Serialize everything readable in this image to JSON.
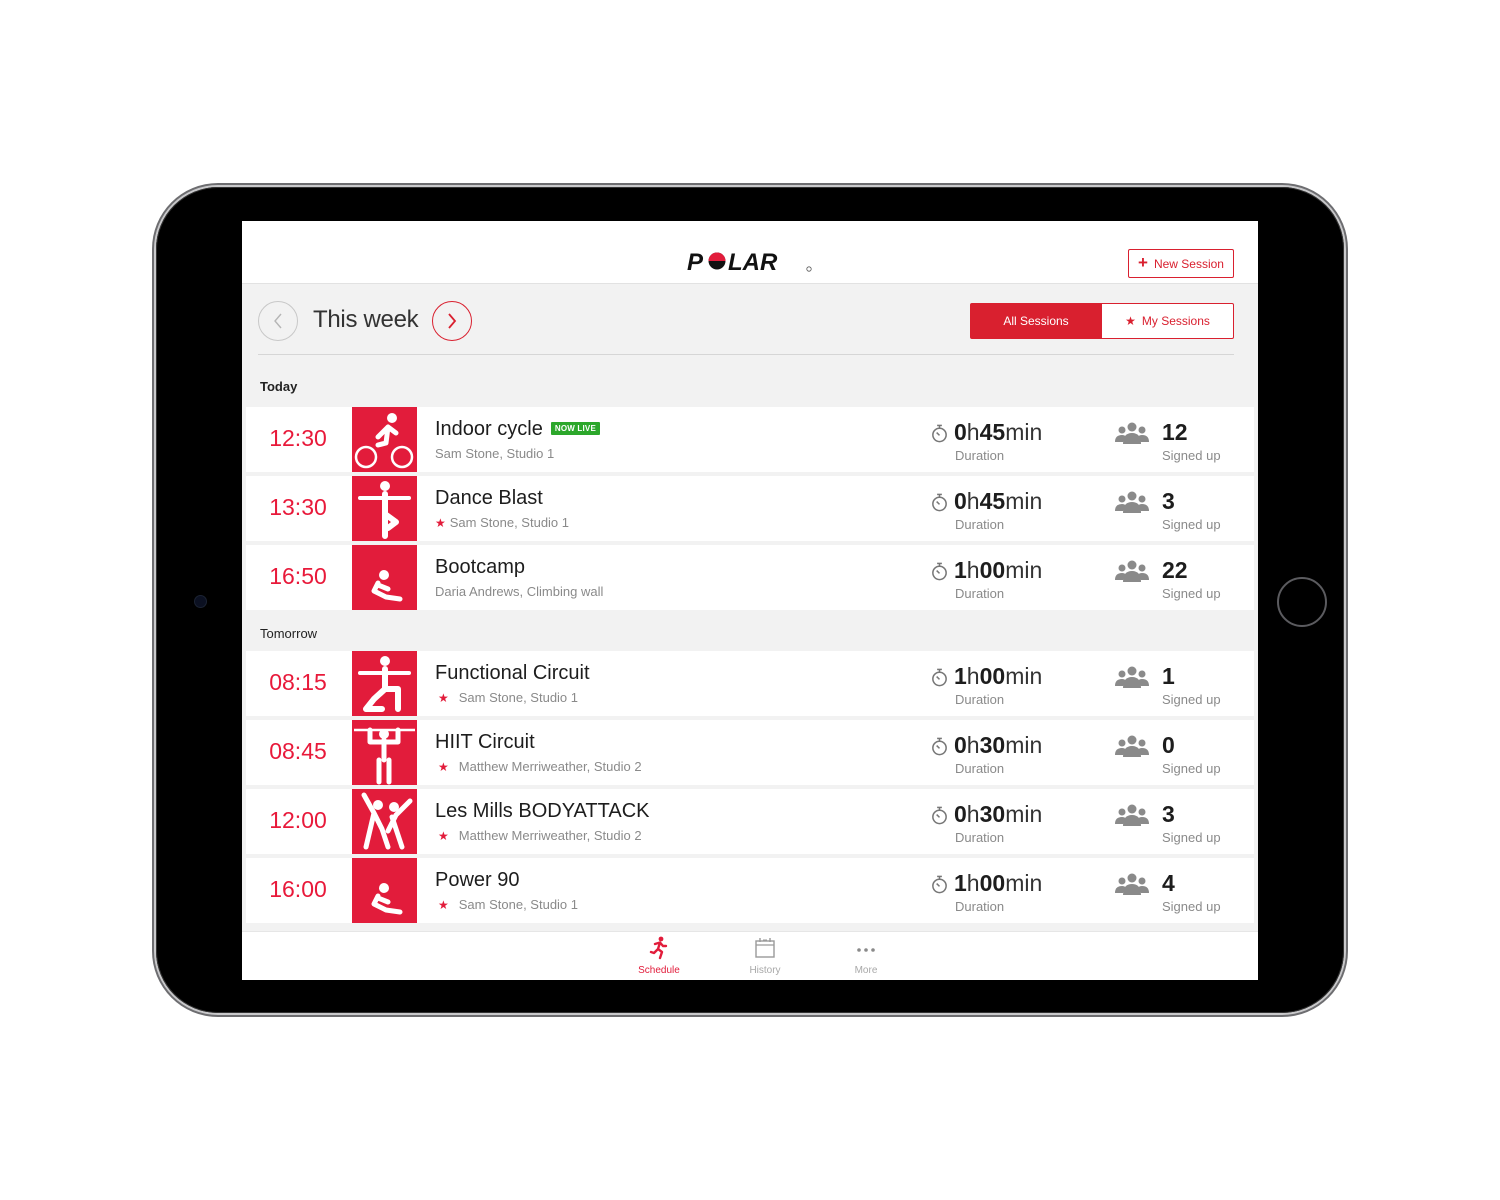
{
  "app": {
    "brand": "POLAR"
  },
  "header": {
    "new_session_label": "New Session"
  },
  "week_nav": {
    "label": "This week",
    "filters": [
      {
        "label": "All Sessions",
        "active": true
      },
      {
        "label": "My Sessions",
        "active": false,
        "icon": "star-icon"
      }
    ]
  },
  "sections": [
    {
      "label": "Today",
      "sessions": [
        {
          "time": "12:30",
          "icon": "cycling-icon",
          "title": "Indoor cycle",
          "badge": "NOW LIVE",
          "starred": false,
          "instructor_location": "Sam Stone, Studio 1",
          "duration": {
            "h": "0",
            "m": "45"
          },
          "signed_up": "12"
        },
        {
          "time": "13:30",
          "icon": "dance-icon",
          "title": "Dance Blast",
          "badge": null,
          "starred": true,
          "instructor_location": "Sam Stone, Studio 1",
          "duration": {
            "h": "0",
            "m": "45"
          },
          "signed_up": "3"
        },
        {
          "time": "16:50",
          "icon": "situp-icon",
          "title": "Bootcamp",
          "badge": null,
          "starred": false,
          "instructor_location": "Daria Andrews, Climbing wall",
          "duration": {
            "h": "1",
            "m": "00"
          },
          "signed_up": "22"
        }
      ]
    },
    {
      "label": "Tomorrow",
      "sessions": [
        {
          "time": "08:15",
          "icon": "lunge-icon",
          "title": "Functional Circuit",
          "badge": null,
          "starred": true,
          "instructor_location": "Sam Stone, Studio 1",
          "duration": {
            "h": "1",
            "m": "00"
          },
          "signed_up": "1"
        },
        {
          "time": "08:45",
          "icon": "pullup-icon",
          "title": "HIIT Circuit",
          "badge": null,
          "starred": true,
          "instructor_location": "Matthew Merriweather, Studio 2",
          "duration": {
            "h": "0",
            "m": "30"
          },
          "signed_up": "0"
        },
        {
          "time": "12:00",
          "icon": "group-exercise-icon",
          "title": "Les Mills BODYATTACK",
          "badge": null,
          "starred": true,
          "instructor_location": "Matthew Merriweather, Studio 2",
          "duration": {
            "h": "0",
            "m": "30"
          },
          "signed_up": "3"
        },
        {
          "time": "16:00",
          "icon": "situp-icon",
          "title": "Power 90",
          "badge": null,
          "starred": true,
          "instructor_location": "Sam Stone, Studio 1",
          "duration": {
            "h": "1",
            "m": "00"
          },
          "signed_up": "4"
        }
      ]
    }
  ],
  "labels": {
    "duration": "Duration",
    "signed_up": "Signed up",
    "hours_unit": "h",
    "minutes_unit": "min"
  },
  "tabbar": {
    "tabs": [
      {
        "label": "Schedule",
        "icon": "running-icon",
        "active": true
      },
      {
        "label": "History",
        "icon": "calendar-icon",
        "active": false
      },
      {
        "label": "More",
        "icon": "more-dots-icon",
        "active": false
      }
    ]
  },
  "colors": {
    "accent": "#e21c3b",
    "live": "#2ca72b",
    "muted": "#8a8a8a"
  }
}
